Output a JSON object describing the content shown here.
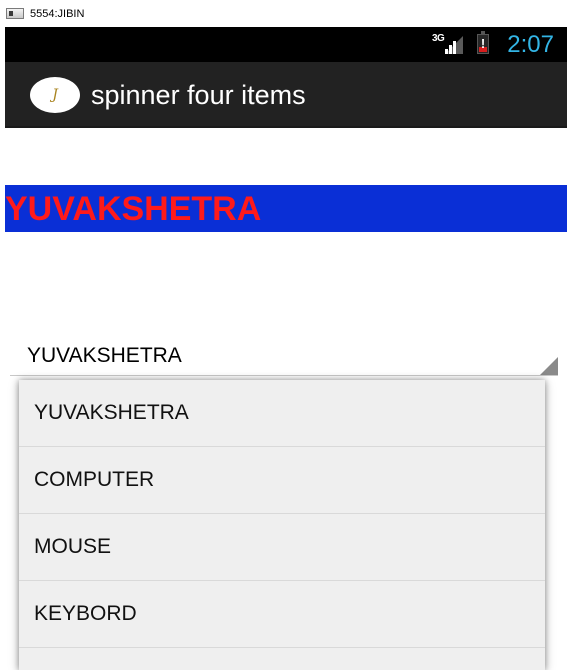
{
  "window": {
    "title": "5554:JIBIN"
  },
  "status_bar": {
    "network": "3G",
    "time": "2:07",
    "clock_color": "#33b5e5",
    "battery_alert": "!",
    "battery_level": 0.3
  },
  "action_bar": {
    "icon_glyph": "J",
    "title": "spinner four items"
  },
  "banner": {
    "text": "YUVAKSHETRA",
    "text_color": "#ff1a1a",
    "background": "#0a2fd6"
  },
  "spinner": {
    "selected": "YUVAKSHETRA",
    "options": [
      "YUVAKSHETRA",
      "COMPUTER",
      "MOUSE",
      "KEYBORD"
    ]
  }
}
